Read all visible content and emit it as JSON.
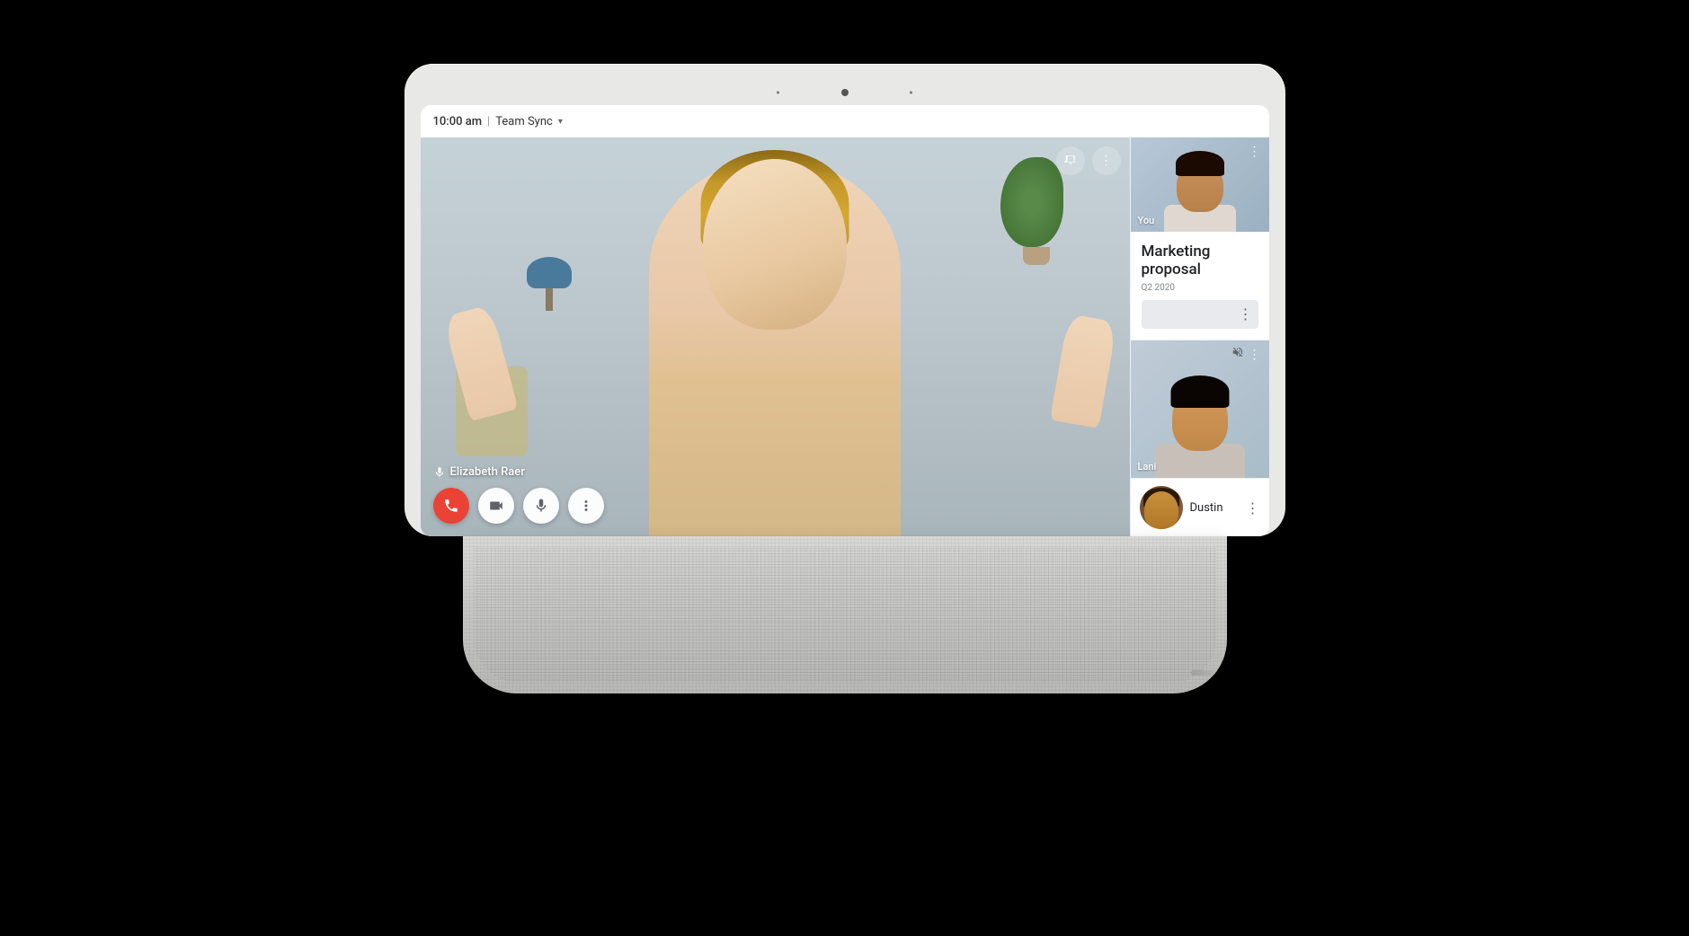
{
  "device": {
    "screen": {
      "topbar": {
        "time": "10:00 am",
        "separator": "|",
        "meeting_name": "Team Sync",
        "dropdown_symbol": "▾"
      },
      "main_video": {
        "speaker_name": "Elizabeth Raer",
        "controls": {
          "end_call_label": "End call",
          "camera_label": "Camera",
          "mic_label": "Microphone",
          "more_label": "More options"
        }
      },
      "sidebar": {
        "you_tile": {
          "label": "You"
        },
        "proposal_card": {
          "title": "Marketing proposal",
          "subtitle": "Q2 2020"
        },
        "lani_tile": {
          "label": "Lani"
        },
        "dustin_row": {
          "label": "Dustin"
        }
      }
    }
  },
  "icons": {
    "end_call": "📞",
    "camera": "□",
    "mic": "🎤",
    "more": "⋮",
    "pin": "📌",
    "mute": "🔇"
  }
}
